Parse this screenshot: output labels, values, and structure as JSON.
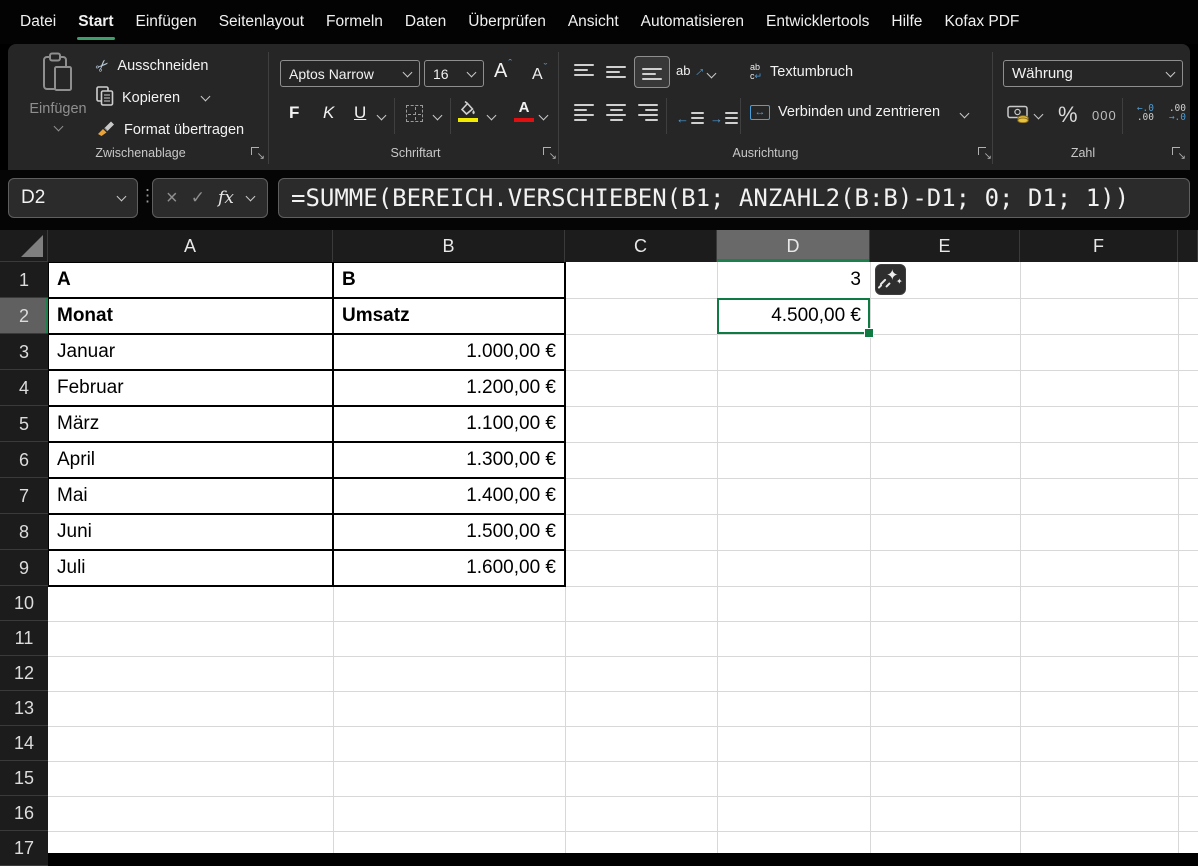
{
  "menu": {
    "tabs": [
      {
        "label": "Datei",
        "active": false
      },
      {
        "label": "Start",
        "active": true
      },
      {
        "label": "Einfügen",
        "active": false
      },
      {
        "label": "Seitenlayout",
        "active": false
      },
      {
        "label": "Formeln",
        "active": false
      },
      {
        "label": "Daten",
        "active": false
      },
      {
        "label": "Überprüfen",
        "active": false
      },
      {
        "label": "Ansicht",
        "active": false
      },
      {
        "label": "Automatisieren",
        "active": false
      },
      {
        "label": "Entwicklertools",
        "active": false
      },
      {
        "label": "Hilfe",
        "active": false
      },
      {
        "label": "Kofax PDF",
        "active": false
      }
    ]
  },
  "ribbon": {
    "clipboard": {
      "group_label": "Zwischenablage",
      "paste_label": "Einfügen",
      "cut_label": "Ausschneiden",
      "copy_label": "Kopieren",
      "format_painter_label": "Format übertragen"
    },
    "font": {
      "group_label": "Schriftart",
      "font_name": "Aptos Narrow",
      "font_size": "16",
      "bold_label": "F",
      "italic_label": "K",
      "underline_label": "U"
    },
    "alignment": {
      "group_label": "Ausrichtung",
      "wrap_label": "Textumbruch",
      "merge_label": "Verbinden und zentrieren"
    },
    "number": {
      "group_label": "Zahl",
      "format_selected": "Währung",
      "percent_label": "%",
      "thousands_label": "000",
      "inc_dec_top": "←.0",
      "inc_dec_bottom": ".00",
      "dec_dec_top": ".00",
      "dec_dec_bottom": "→.0"
    }
  },
  "formula_bar": {
    "name_box": "D2",
    "cancel_label": "×",
    "enter_label": "✓",
    "fx_label": "fx",
    "formula": "=SUMME(BEREICH.VERSCHIEBEN(B1; ANZAHL2(B:B)-D1; 0; D1; 1))"
  },
  "sheet": {
    "column_headers": [
      "A",
      "B",
      "C",
      "D",
      "E",
      "F"
    ],
    "selected_column": "D",
    "rows": [
      "1",
      "2",
      "3",
      "4",
      "5",
      "6",
      "7",
      "8",
      "9",
      "10",
      "11",
      "12",
      "13",
      "14",
      "15",
      "16",
      "17"
    ],
    "selected_row": "2",
    "active_cell": "D2",
    "cells": [
      {
        "ref": "A1",
        "text": "A",
        "bold": true,
        "align": "left"
      },
      {
        "ref": "B1",
        "text": "B",
        "bold": true,
        "align": "left"
      },
      {
        "ref": "A2",
        "text": "Monat",
        "bold": true,
        "align": "left"
      },
      {
        "ref": "B2",
        "text": "Umsatz",
        "bold": true,
        "align": "left"
      },
      {
        "ref": "A3",
        "text": "Januar",
        "align": "left"
      },
      {
        "ref": "B3",
        "text": "1.000,00 €",
        "align": "right"
      },
      {
        "ref": "A4",
        "text": "Februar",
        "align": "left"
      },
      {
        "ref": "B4",
        "text": "1.200,00 €",
        "align": "right"
      },
      {
        "ref": "A5",
        "text": "März",
        "align": "left"
      },
      {
        "ref": "B5",
        "text": "1.100,00 €",
        "align": "right"
      },
      {
        "ref": "A6",
        "text": "April",
        "align": "left"
      },
      {
        "ref": "B6",
        "text": "1.300,00 €",
        "align": "right"
      },
      {
        "ref": "A7",
        "text": "Mai",
        "align": "left"
      },
      {
        "ref": "B7",
        "text": "1.400,00 €",
        "align": "right"
      },
      {
        "ref": "A8",
        "text": "Juni",
        "align": "left"
      },
      {
        "ref": "B8",
        "text": "1.500,00 €",
        "align": "right"
      },
      {
        "ref": "A9",
        "text": "Juli",
        "align": "left"
      },
      {
        "ref": "B9",
        "text": "1.600,00 €",
        "align": "right"
      },
      {
        "ref": "D1",
        "text": "3",
        "align": "right"
      },
      {
        "ref": "D2",
        "text": "4.500,00 €",
        "align": "right",
        "active": true
      }
    ]
  },
  "icons": {
    "scissors-icon": "✂",
    "sparkle-icon": "✦",
    "dropdown-chevron": "v",
    "dialog-launcher-icon": "↘",
    "cancel-icon": "×",
    "enter-icon": "✓",
    "orientation-arrow": "→",
    "wrap-return": "↵",
    "merge-arrows": "↔"
  },
  "colors": {
    "accent_green": "#3f9e6e",
    "selection_green": "#0f7b42",
    "header_highlight": "#696969",
    "fill_yellow": "#f2ea00",
    "font_color_red": "#e01010",
    "icon_blue": "#4a9eda",
    "ribbon_bg": "#262626",
    "grid_line": "#d8d8d8"
  }
}
